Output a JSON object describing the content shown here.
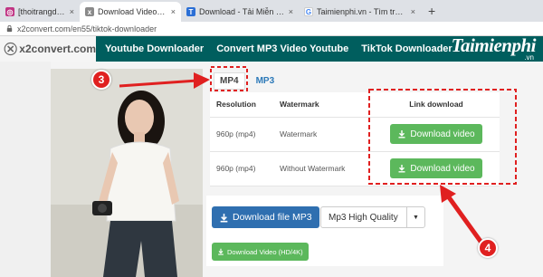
{
  "browser": {
    "tabs": [
      {
        "label": "[thoitrangdep3] Tiề",
        "favicon": "instagram-icon",
        "favicon_color": "#c13584"
      },
      {
        "label": "Download Video from TikTok Wi",
        "favicon": "x2convert-icon",
        "favicon_color": "#8a8a8a"
      },
      {
        "label": "Download - Tải Miễn Phí VN - Pe",
        "favicon": "taimienphi-icon",
        "favicon_color": "#2b6fd6"
      },
      {
        "label": "Taimienphi.vn - Tìm trên Google",
        "favicon": "google-icon",
        "favicon_color": "#4285f4"
      }
    ],
    "close_glyph": "×",
    "new_tab_glyph": "+",
    "url": "x2convert.com/en55/tiktok-downloader"
  },
  "header": {
    "logo_text": "x2convert.com",
    "nav": [
      "Youtube Downloader",
      "Convert MP3 Video Youtube",
      "TikTok Downloader"
    ],
    "brand_name": "Taimienphi",
    "brand_sub": ".vn",
    "bg_color": "#005e5e"
  },
  "downloader": {
    "format_tabs": [
      "MP4",
      "MP3"
    ],
    "table": {
      "headers": [
        "Resolution",
        "Watermark",
        "Link download"
      ],
      "rows": [
        {
          "resolution": "960p (mp4)",
          "watermark": "Watermark",
          "button": "Download video"
        },
        {
          "resolution": "960p (mp4)",
          "watermark": "Without Watermark",
          "button": "Download video"
        }
      ]
    },
    "mp3": {
      "download_label": "Download file MP3",
      "quality_selected": "Mp3 High Quality",
      "hd_label": "Download Video (HD/4K)"
    }
  },
  "annotations": {
    "steps": [
      "3",
      "4"
    ],
    "accent_color": "#e02020"
  }
}
